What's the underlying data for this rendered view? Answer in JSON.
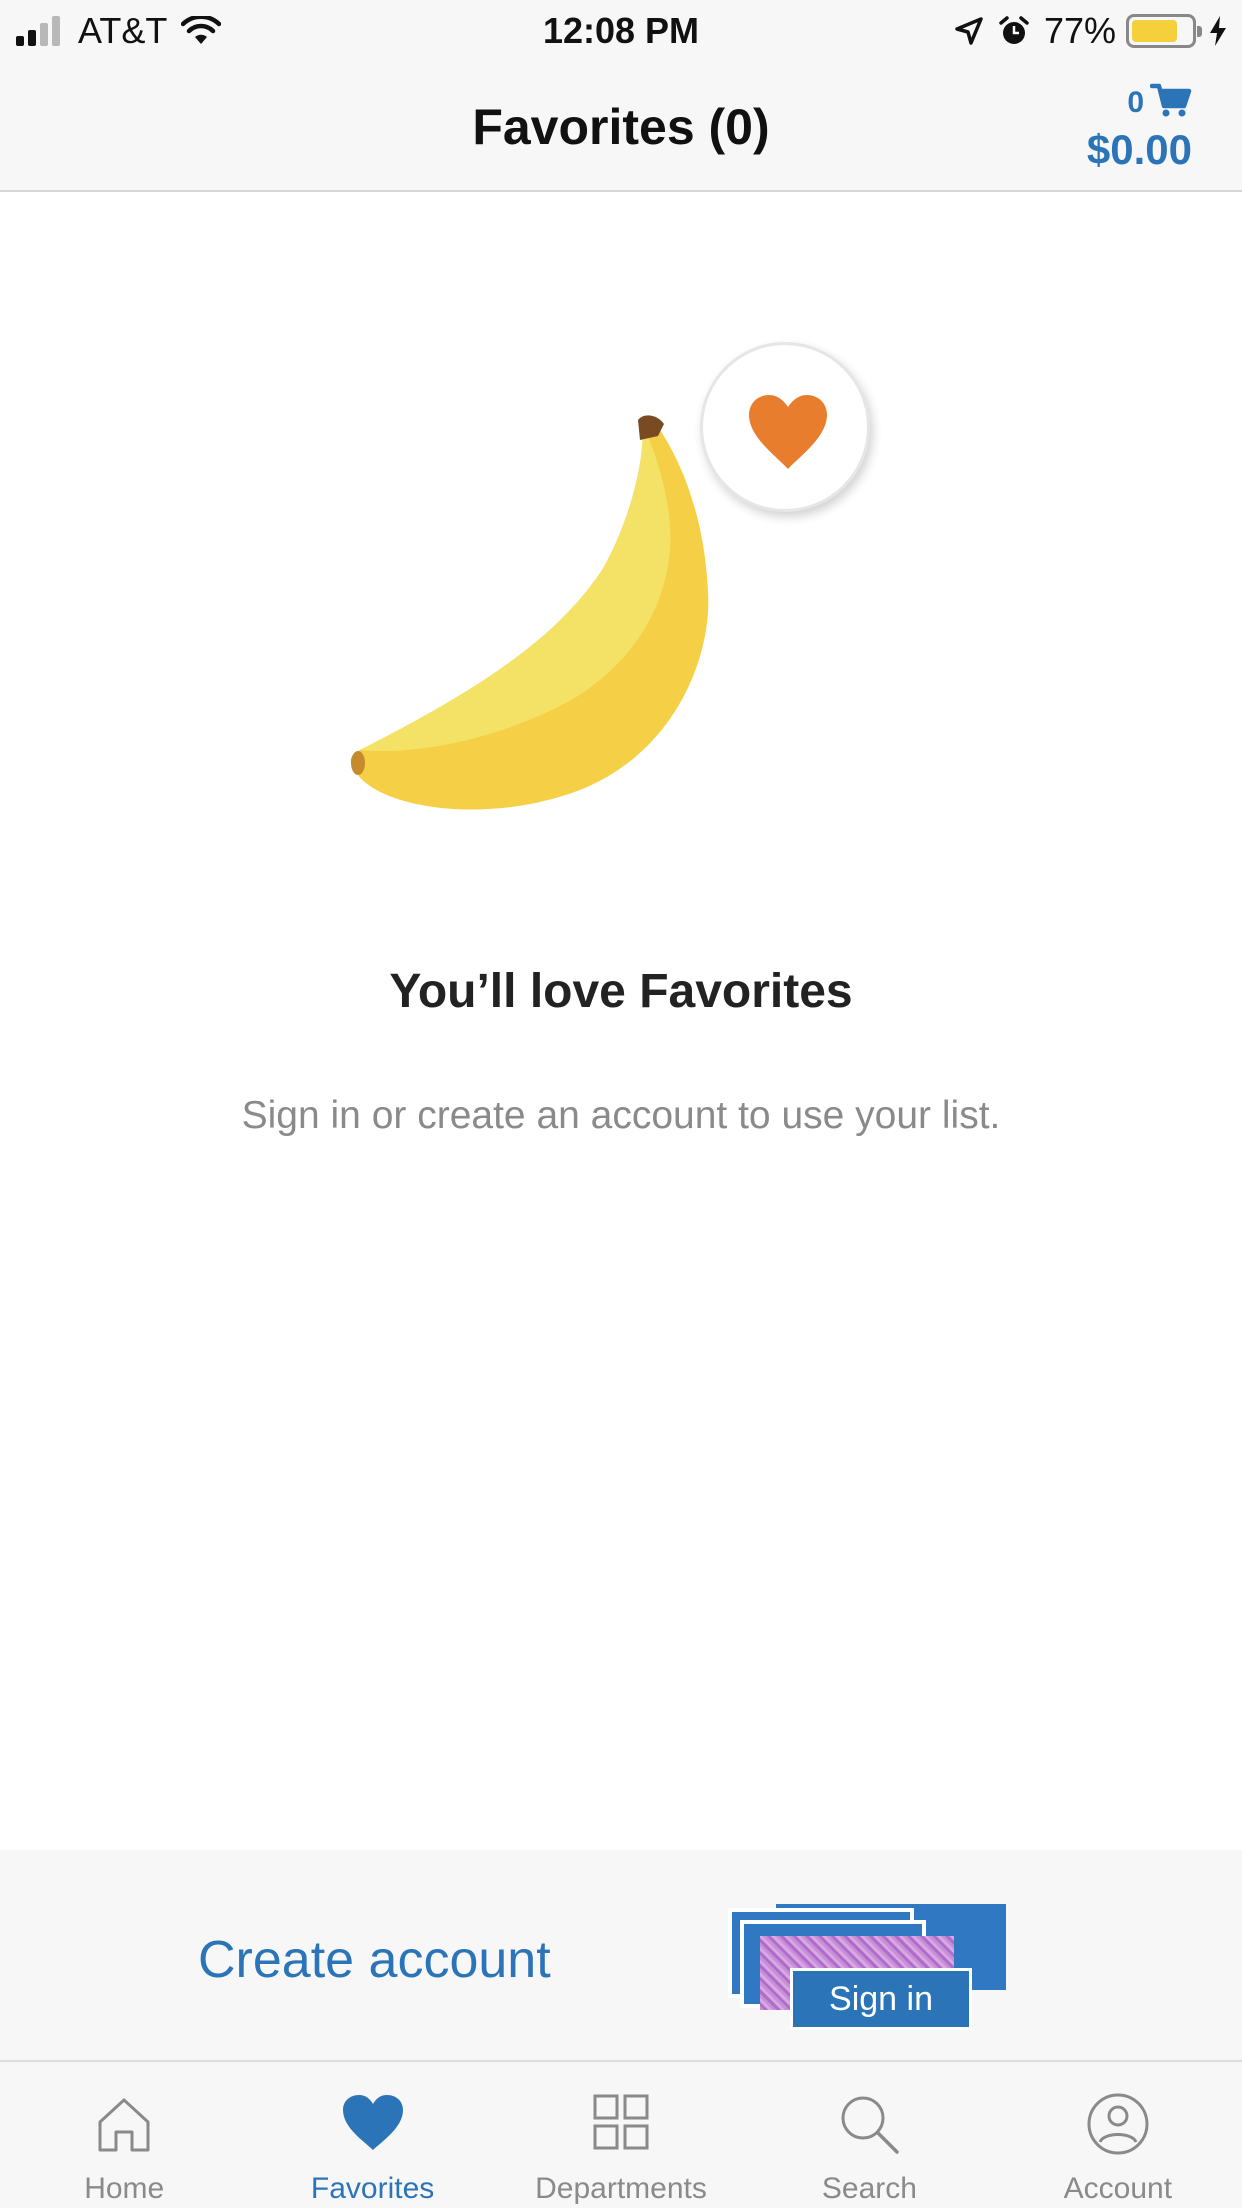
{
  "status_bar": {
    "carrier": "AT&T",
    "time": "12:08 PM",
    "battery_percent": "77%",
    "battery_level": 0.77,
    "icons": [
      "signal-icon",
      "wifi-icon",
      "location-arrow-icon",
      "alarm-icon",
      "battery-icon",
      "charging-bolt-icon"
    ]
  },
  "header": {
    "title": "Favorites (0)",
    "cart_count": "0",
    "cart_total": "$0.00",
    "cart_icon": "cart-icon"
  },
  "empty_state": {
    "illustration": "banana-with-heart",
    "title": "You’ll love Favorites",
    "message": "Sign in or create an account to use your list."
  },
  "actions": {
    "create_account": "Create account",
    "sign_in": "Sign in"
  },
  "tab_bar": {
    "items": [
      {
        "label": "Home",
        "icon": "home-icon"
      },
      {
        "label": "Favorites",
        "icon": "heart-icon",
        "active": true
      },
      {
        "label": "Departments",
        "icon": "grid-icon"
      },
      {
        "label": "Search",
        "icon": "search-icon"
      },
      {
        "label": "Account",
        "icon": "account-icon"
      }
    ]
  },
  "colors": {
    "accent": "#2c74b8",
    "heart": "#e87d2e",
    "banana": "#f5cf45",
    "background": "#ffffff",
    "bar_background": "#f7f7f7",
    "muted_text": "#8a8a8a"
  }
}
